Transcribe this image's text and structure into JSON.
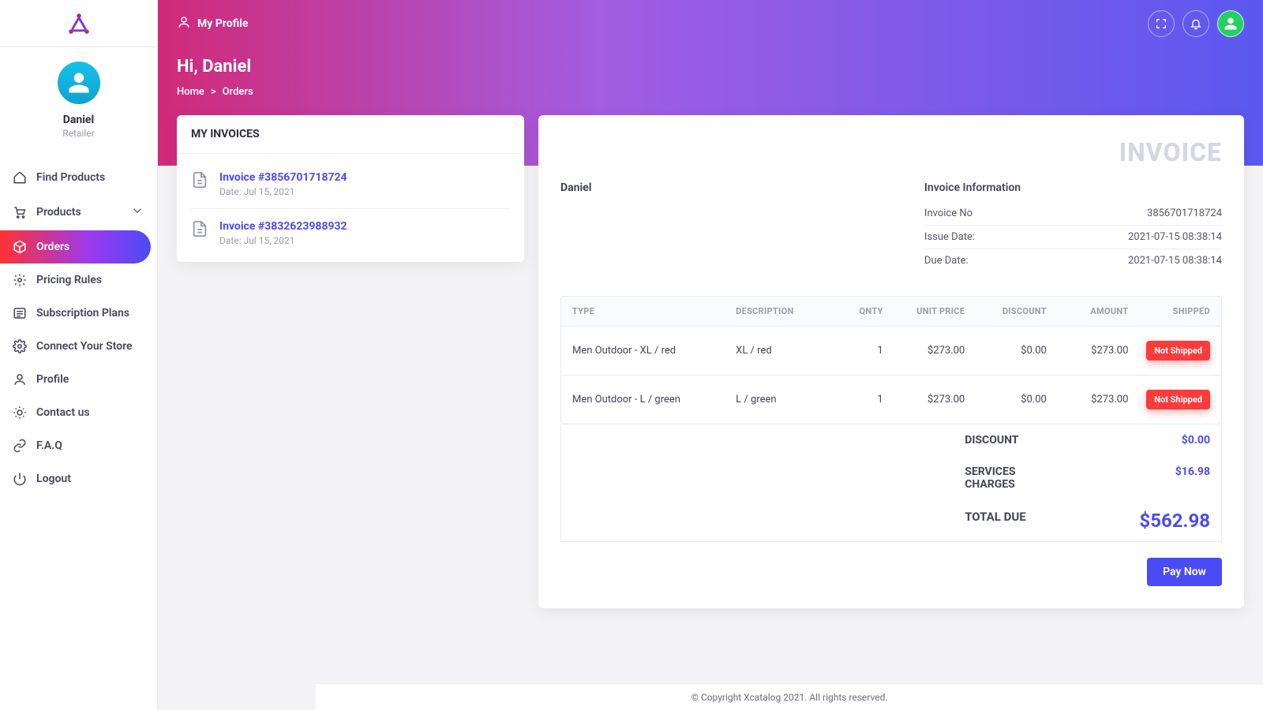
{
  "colors": {
    "accent": "#4b4bf5",
    "danger": "#ff3a3a"
  },
  "sidebar": {
    "user_name": "Daniel",
    "user_role": "Retailer",
    "items": [
      {
        "label": "Find Products",
        "icon": "home"
      },
      {
        "label": "Products",
        "icon": "cart",
        "expandable": true
      },
      {
        "label": "Orders",
        "icon": "box"
      },
      {
        "label": "Pricing Rules",
        "icon": "gear"
      },
      {
        "label": "Subscription Plans",
        "icon": "list"
      },
      {
        "label": "Connect Your Store",
        "icon": "settings"
      },
      {
        "label": "Profile",
        "icon": "user"
      },
      {
        "label": "Contact us",
        "icon": "sun"
      },
      {
        "label": "F.A.Q",
        "icon": "link"
      },
      {
        "label": "Logout",
        "icon": "power"
      }
    ]
  },
  "topbar": {
    "title": "My Profile"
  },
  "hero": {
    "greeting": "Hi, Daniel",
    "breadcrumb": [
      "Home",
      ">",
      "Orders"
    ]
  },
  "invoice_list": {
    "title": "MY INVOICES",
    "items": [
      {
        "title": "Invoice #3856701718724",
        "date": "Date: Jul 15, 2021"
      },
      {
        "title": "Invoice #3832623988932",
        "date": "Date: Jul 15, 2021"
      }
    ]
  },
  "invoice": {
    "watermark": "INVOICE",
    "customer": "Daniel",
    "info_title": "Invoice Information",
    "info": [
      {
        "label": "Invoice No",
        "value": "3856701718724"
      },
      {
        "label": "Issue Date:",
        "value": "2021-07-15 08:38:14"
      },
      {
        "label": "Due Date:",
        "value": "2021-07-15 08:38:14"
      }
    ],
    "columns": [
      "TYPE",
      "DESCRIPTION",
      "QNTY",
      "UNIT PRICE",
      "DISCOUNT",
      "AMOUNT",
      "SHIPPED"
    ],
    "rows": [
      {
        "type": "Men Outdoor - XL / red",
        "desc": "XL / red",
        "qty": "1",
        "unit": "$273.00",
        "disc": "$0.00",
        "amount": "$273.00",
        "shipped": "Not Shipped"
      },
      {
        "type": "Men Outdoor - L / green",
        "desc": "L / green",
        "qty": "1",
        "unit": "$273.00",
        "disc": "$0.00",
        "amount": "$273.00",
        "shipped": "Not Shipped"
      }
    ],
    "totals": [
      {
        "label": "DISCOUNT",
        "value": "$0.00"
      },
      {
        "label": "SERVICES CHARGES",
        "value": "$16.98"
      },
      {
        "label": "TOTAL DUE",
        "value": "$562.98"
      }
    ],
    "pay_label": "Pay Now"
  },
  "footer": "© Copyright Xcatalog 2021. All rights reserved."
}
